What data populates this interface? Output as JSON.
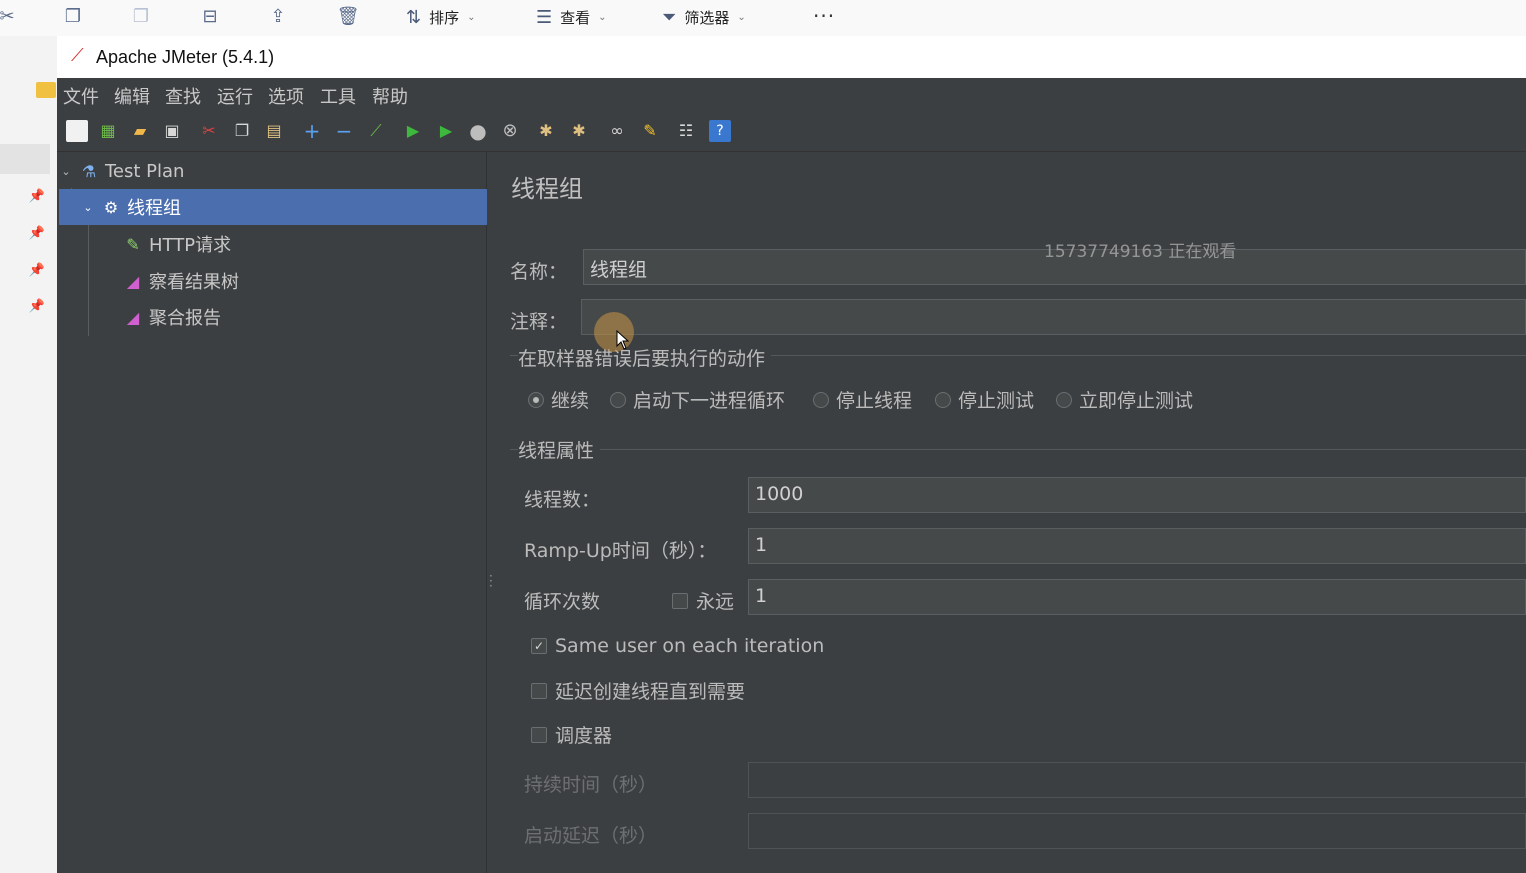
{
  "explorer_toolbar": {
    "sort_label": "排序",
    "view_label": "查看",
    "filter_label": "筛选器",
    "more_label": "···"
  },
  "window": {
    "title": "Apache JMeter (5.4.1)"
  },
  "menubar": {
    "items": [
      "文件",
      "编辑",
      "查找",
      "运行",
      "选项",
      "工具",
      "帮助"
    ]
  },
  "tree": {
    "items": [
      {
        "label": "Test Plan",
        "icon": "flask-icon"
      },
      {
        "label": "线程组",
        "icon": "gear-icon",
        "selected": true
      },
      {
        "label": "HTTP请求",
        "icon": "pencil-icon"
      },
      {
        "label": "察看结果树",
        "icon": "graph-icon"
      },
      {
        "label": "聚合报告",
        "icon": "graph-icon"
      }
    ]
  },
  "editor": {
    "heading": "线程组",
    "name_label": "名称：",
    "name_value": "线程组",
    "comment_label": "注释：",
    "comment_value": "",
    "error_action_title": "在取样器错误后要执行的动作",
    "error_actions": [
      "继续",
      "启动下一进程循环",
      "停止线程",
      "停止测试",
      "立即停止测试"
    ],
    "error_action_selected": "继续",
    "thread_props_title": "线程属性",
    "thread_count_label": "线程数：",
    "thread_count_value": "1000",
    "rampup_label": "Ramp-Up时间（秒）：",
    "rampup_value": "1",
    "loop_label": "循环次数",
    "forever_label": "永远",
    "forever_checked": false,
    "loop_value": "1",
    "same_user_label": "Same user on each iteration",
    "same_user_checked": true,
    "delay_create_label": "延迟创建线程直到需要",
    "delay_create_checked": false,
    "scheduler_label": "调度器",
    "scheduler_checked": false,
    "duration_label": "持续时间（秒）",
    "duration_value": "",
    "startup_delay_label": "启动延迟（秒）",
    "startup_delay_value": ""
  },
  "overlay": {
    "watermark": "15737749163 正在观看"
  },
  "colors": {
    "jmeter_bg": "#3c3f41",
    "selection": "#4b6eaf",
    "field_bg": "#45494a"
  }
}
